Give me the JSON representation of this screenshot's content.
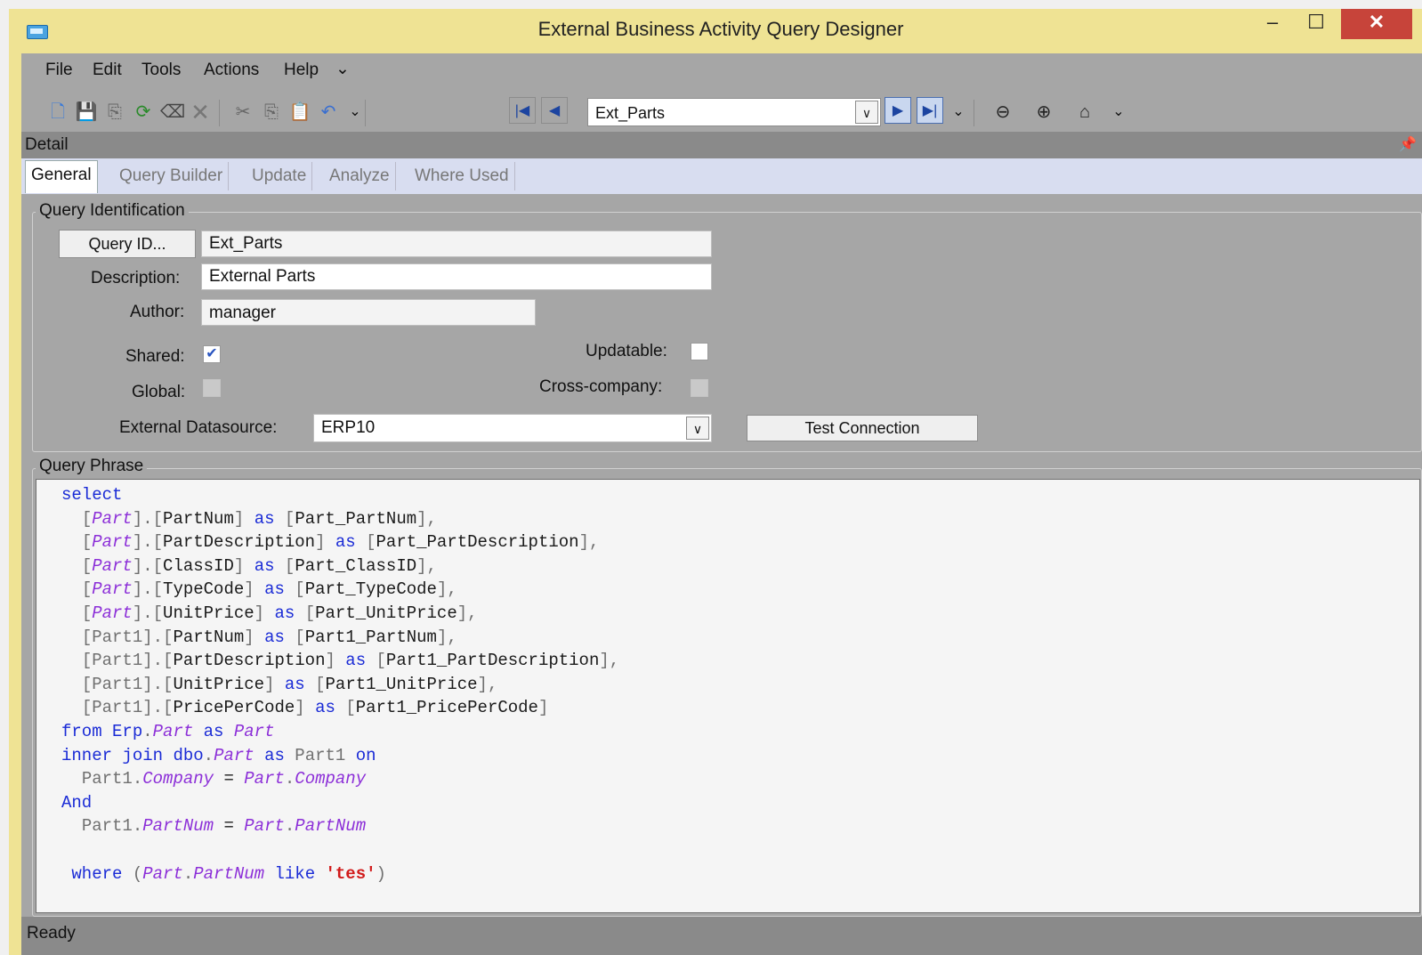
{
  "window": {
    "title": "External Business Activity Query Designer",
    "min": "–",
    "max": "☐",
    "close": "✕"
  },
  "menu": [
    "File",
    "Edit",
    "Tools",
    "Actions",
    "Help",
    "⌄"
  ],
  "toolbar": {
    "combo_value": "Ext_Parts",
    "icons": [
      "new-icon",
      "save-icon",
      "copy-record-icon",
      "refresh-icon",
      "clear-icon",
      "delete-icon",
      "cut-icon",
      "copy-icon",
      "paste-icon",
      "undo-icon",
      "first-icon",
      "previous-icon",
      "next-icon",
      "last-icon",
      "back-icon",
      "forward-icon",
      "home-icon"
    ]
  },
  "detail": {
    "label": "Detail",
    "pin": "📌"
  },
  "tabs": [
    "General",
    "Query Builder",
    "Update",
    "Analyze",
    "Where Used"
  ],
  "query_identification": {
    "title": "Query Identification",
    "query_id_button": "Query ID...",
    "query_id_value": "Ext_Parts",
    "description_label": "Description:",
    "description_value": "External Parts",
    "author_label": "Author:",
    "author_value": "manager",
    "shared_label": "Shared:",
    "shared": true,
    "updatable_label": "Updatable:",
    "updatable": false,
    "global_label": "Global:",
    "global": false,
    "cross_company_label": "Cross-company:",
    "cross_company": false,
    "datasource_label": "External Datasource:",
    "datasource_value": "ERP10",
    "test_connection_button": "Test Connection"
  },
  "query_phrase": {
    "title": "Query Phrase",
    "lines": [
      "select",
      "  [Part].[PartNum] as [Part_PartNum],",
      "  [Part].[PartDescription] as [Part_PartDescription],",
      "  [Part].[ClassID] as [Part_ClassID],",
      "  [Part].[TypeCode] as [Part_TypeCode],",
      "  [Part].[UnitPrice] as [Part_UnitPrice],",
      "  [Part1].[PartNum] as [Part1_PartNum],",
      "  [Part1].[PartDescription] as [Part1_PartDescription],",
      "  [Part1].[UnitPrice] as [Part1_UnitPrice],",
      "  [Part1].[PricePerCode] as [Part1_PricePerCode]",
      "from Erp.Part as Part",
      "inner join dbo.Part as Part1 on",
      "  Part1.Company = Part.Company",
      "And",
      "  Part1.PartNum = Part.PartNum",
      "",
      " where (Part.PartNum like 'tes')"
    ]
  },
  "status": {
    "text": "Ready"
  }
}
